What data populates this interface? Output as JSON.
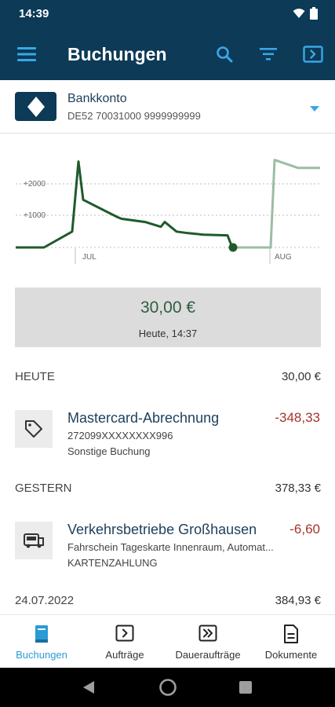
{
  "status_bar": {
    "time": "14:39"
  },
  "app_bar": {
    "title": "Buchungen"
  },
  "account": {
    "name": "Bankkonto",
    "iban": "DE52 70031000 9999999999"
  },
  "chart_data": {
    "type": "line",
    "y_tick_labels": [
      "+2000",
      "+1000"
    ],
    "x_tick_labels": [
      "JUL",
      "AUG"
    ],
    "grid": true,
    "series": [
      {
        "values": [
          0,
          0,
          0,
          500,
          2700,
          1500,
          950,
          900,
          800,
          650,
          800,
          500,
          450,
          400,
          380,
          0
        ]
      },
      {
        "values": [
          0,
          0,
          0,
          0,
          2750,
          2500,
          2500
        ]
      }
    ]
  },
  "balance": {
    "amount": "30,00 €",
    "time": "Heute, 14:37"
  },
  "groups": [
    {
      "label": "HEUTE",
      "total": "30,00 €",
      "tx": {
        "title": "Mastercard-Abrechnung",
        "amount": "-348,33",
        "sub1": "272099XXXXXXXX996",
        "sub2": "Sonstige Buchung"
      }
    },
    {
      "label": "GESTERN",
      "total": "378,33 €",
      "tx": {
        "title": "Verkehrsbetriebe Großhausen",
        "amount": "-6,60",
        "sub1": "Fahrschein Tageskarte Innenraum, Automat...",
        "sub2": "KARTENZAHLUNG"
      }
    },
    {
      "label": "24.07.2022",
      "total": "384,93 €"
    }
  ],
  "nav": [
    {
      "label": "Buchungen",
      "icon": "book-icon",
      "active": true
    },
    {
      "label": "Aufträge",
      "icon": "order-icon"
    },
    {
      "label": "Daueraufträge",
      "icon": "standing-order-icon"
    },
    {
      "label": "Dokumente",
      "icon": "document-icon"
    }
  ],
  "colors": {
    "primary": "#0c3a57",
    "accent": "#2a9ad6",
    "chart_past": "#1f5a2c",
    "chart_future": "#9cbca5",
    "negative": "#a8322d",
    "balance": "#2d5e3d"
  }
}
